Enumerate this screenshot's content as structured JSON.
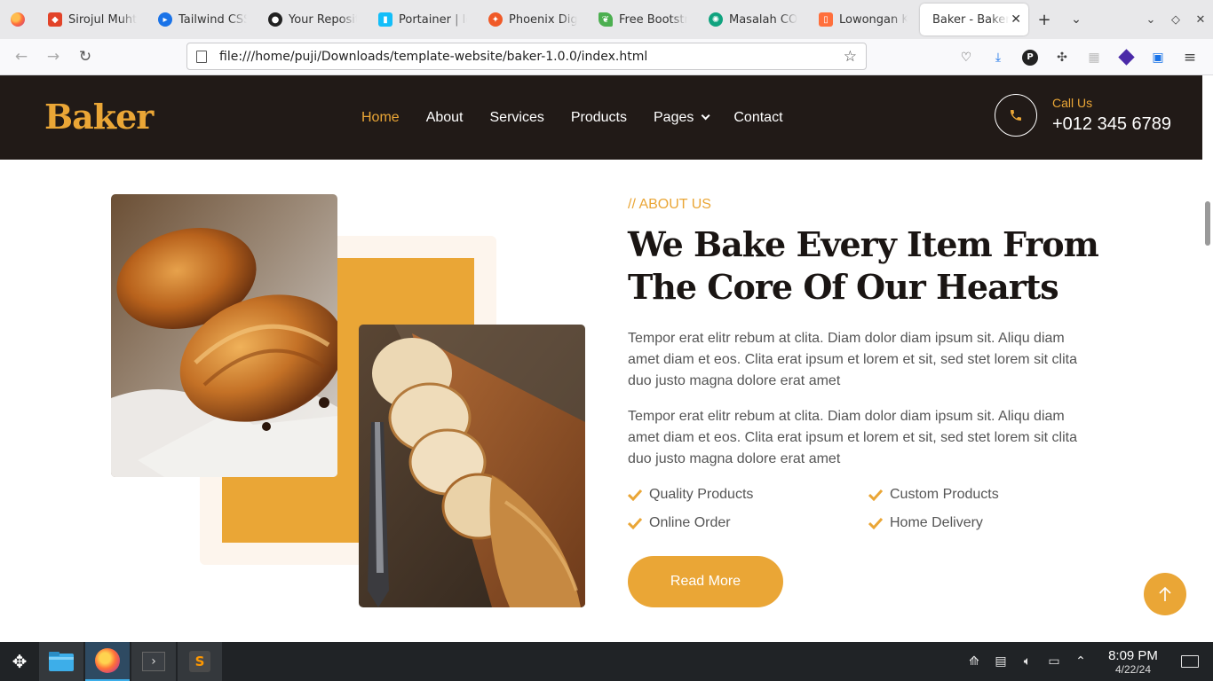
{
  "browser": {
    "tabs": [
      {
        "title": "Sirojul Muhtar",
        "favicon": "gitlab-icon",
        "color": "#e24329"
      },
      {
        "title": "Tailwind CSS",
        "favicon": "tailwind-icon",
        "color": "#1a73e8"
      },
      {
        "title": "Your Repositories",
        "favicon": "github-icon",
        "color": "#222222"
      },
      {
        "title": "Portainer | localhost",
        "favicon": "portainer-icon",
        "color": "#13bef9"
      },
      {
        "title": "Phoenix Digital",
        "favicon": "phoenix-icon",
        "color": "#f05a28"
      },
      {
        "title": "Free Bootstrap",
        "favicon": "bootstrap-leaf-icon",
        "color": "#4caf50"
      },
      {
        "title": "Masalah CORS",
        "favicon": "chatgpt-icon",
        "color": "#10a37f"
      },
      {
        "title": "Lowongan Kerja",
        "favicon": "job-icon",
        "color": "#ff6f3c"
      }
    ],
    "active_tab": {
      "title": "Baker - Bakery Website"
    },
    "url": "file:///home/puji/Downloads/template-website/baker-1.0.0/index.html"
  },
  "site": {
    "brand": "Baker",
    "accent": "#eaa636",
    "dark": "#211a17",
    "nav": [
      {
        "label": "Home",
        "key": "home"
      },
      {
        "label": "About",
        "key": "about"
      },
      {
        "label": "Services",
        "key": "services"
      },
      {
        "label": "Products",
        "key": "products"
      },
      {
        "label": "Pages",
        "key": "pages"
      },
      {
        "label": "Contact",
        "key": "contact"
      }
    ],
    "call_label": "Call Us",
    "call_number": "+012 345 6789"
  },
  "about": {
    "kicker": "// ABOUT US",
    "headline": "We Bake Every Item From The Core Of Our Hearts",
    "paragraph1": "Tempor erat elitr rebum at clita. Diam dolor diam ipsum sit. Aliqu diam amet diam et eos. Clita erat ipsum et lorem et sit, sed stet lorem sit clita duo justo magna dolore erat amet",
    "paragraph2": "Tempor erat elitr rebum at clita. Diam dolor diam ipsum sit. Aliqu diam amet diam et eos. Clita erat ipsum et lorem et sit, sed stet lorem sit clita duo justo magna dolore erat amet",
    "features": [
      "Quality Products",
      "Custom Products",
      "Online Order",
      "Home Delivery"
    ],
    "button": "Read More"
  },
  "taskbar": {
    "time": "8:09 PM",
    "date": "4/22/24",
    "apps": [
      "file-manager-icon",
      "firefox-icon",
      "terminal-icon",
      "sublime-text-icon"
    ]
  }
}
